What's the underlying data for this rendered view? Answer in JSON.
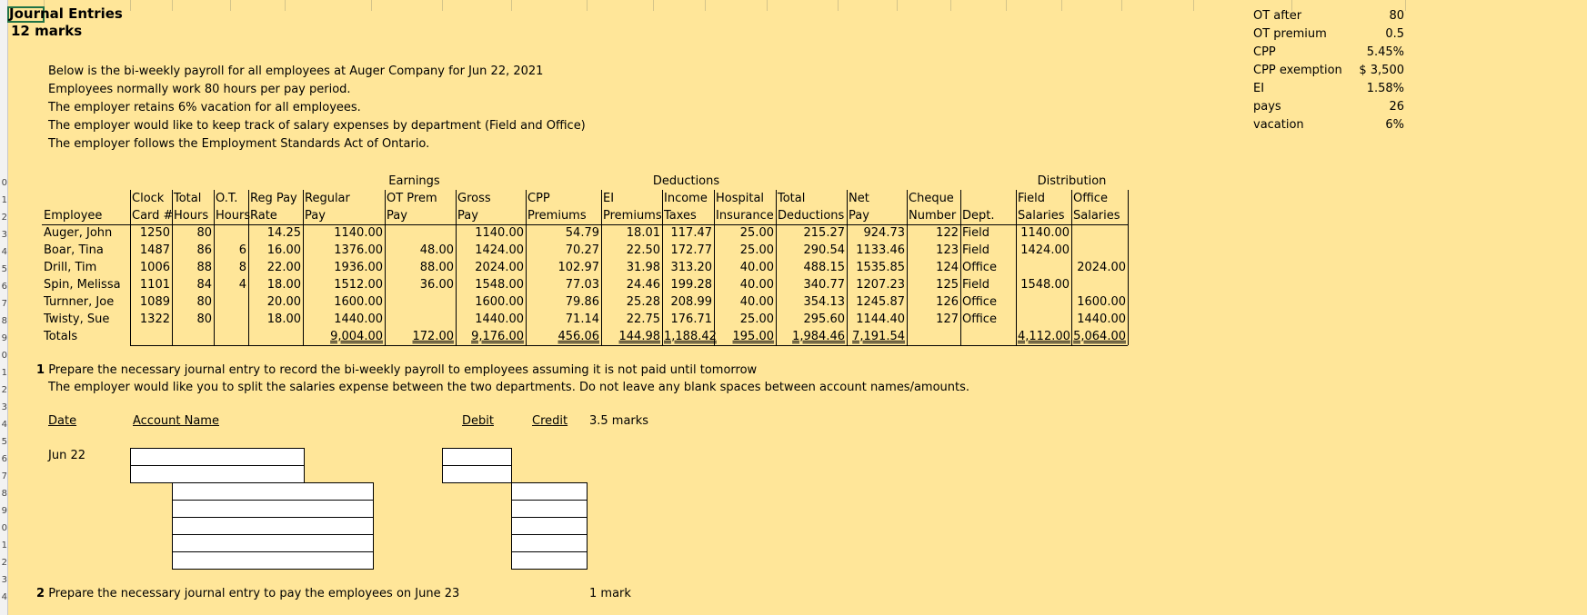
{
  "title": "Journal Entries",
  "marks": "12 marks",
  "intro": [
    "Below is the bi-weekly payroll for all employees at Auger Company for Jun 22, 2021",
    "Employees normally work 80 hours per pay period.",
    "The employer retains 6% vacation for all employees.",
    "The employer would like to keep track of salary expenses by department (Field and Office)",
    "The employer follows the Employment Standards Act of Ontario."
  ],
  "params": [
    {
      "label": "OT after",
      "value": "80"
    },
    {
      "label": "OT premium",
      "value": "0.5"
    },
    {
      "label": "CPP",
      "value": "5.45%"
    },
    {
      "label": "CPP exemption",
      "value": "$  3,500"
    },
    {
      "label": "EI",
      "value": "1.58%"
    },
    {
      "label": "pays",
      "value": "26"
    },
    {
      "label": "vacation",
      "value": "6%"
    }
  ],
  "groups": {
    "earnings": "Earnings",
    "deductions": "Deductions",
    "distribution": "Distribution"
  },
  "headers": {
    "row1": [
      "",
      "Clock",
      "Total",
      "O.T.",
      "Reg Pay",
      "Regular",
      "OT Prem",
      "Gross",
      "CPP",
      "EI",
      "Income",
      "Hospital",
      "Total",
      "Net",
      "Cheque",
      "",
      "Field",
      "Office"
    ],
    "row2": [
      "Employee",
      "Card #",
      "Hours",
      "Hours",
      "Rate",
      "Pay",
      "Pay",
      "Pay",
      "Premiums",
      "Premiums",
      "Taxes",
      "Insurance",
      "Deductions",
      "Pay",
      "Number",
      "Dept.",
      "Salaries",
      "Salaries"
    ]
  },
  "rows": [
    [
      "Auger, John",
      "1250",
      "80",
      "",
      "14.25",
      "1140.00",
      "",
      "1140.00",
      "54.79",
      "18.01",
      "117.47",
      "25.00",
      "215.27",
      "924.73",
      "122",
      "Field",
      "1140.00",
      ""
    ],
    [
      "Boar, Tina",
      "1487",
      "86",
      "6",
      "16.00",
      "1376.00",
      "48.00",
      "1424.00",
      "70.27",
      "22.50",
      "172.77",
      "25.00",
      "290.54",
      "1133.46",
      "123",
      "Field",
      "1424.00",
      ""
    ],
    [
      "Drill, Tim",
      "1006",
      "88",
      "8",
      "22.00",
      "1936.00",
      "88.00",
      "2024.00",
      "102.97",
      "31.98",
      "313.20",
      "40.00",
      "488.15",
      "1535.85",
      "124",
      "Office",
      "",
      "2024.00"
    ],
    [
      "Spin, Melissa",
      "1101",
      "84",
      "4",
      "18.00",
      "1512.00",
      "36.00",
      "1548.00",
      "77.03",
      "24.46",
      "199.28",
      "40.00",
      "340.77",
      "1207.23",
      "125",
      "Field",
      "1548.00",
      ""
    ],
    [
      "Turnner, Joe",
      "1089",
      "80",
      "",
      "20.00",
      "1600.00",
      "",
      "1600.00",
      "79.86",
      "25.28",
      "208.99",
      "40.00",
      "354.13",
      "1245.87",
      "126",
      "Office",
      "",
      "1600.00"
    ],
    [
      "Twisty, Sue",
      "1322",
      "80",
      "",
      "18.00",
      "1440.00",
      "",
      "1440.00",
      "71.14",
      "22.75",
      "176.71",
      "25.00",
      "295.60",
      "1144.40",
      "127",
      "Office",
      "",
      "1440.00"
    ]
  ],
  "totals": [
    "Totals",
    "",
    "",
    "",
    "",
    "9,004.00",
    "172.00",
    "9,176.00",
    "456.06",
    "144.98",
    "1,188.42",
    "195.00",
    "1,984.46",
    "7,191.54",
    "",
    "",
    "4,112.00",
    "5,064.00"
  ],
  "q1": {
    "number": "1",
    "line1": "Prepare the necessary journal entry to record the bi-weekly payroll to employees assuming it is not paid until tomorrow",
    "line2": "The employer would like you to split the salaries expense between the two departments.  Do not leave any blank spaces between account names/amounts."
  },
  "je_headers": {
    "date": "Date",
    "account": "Account Name",
    "debit": "Debit",
    "credit": "Credit",
    "marks": "3.5 marks"
  },
  "je_date": "Jun 22",
  "q2": {
    "number": "2",
    "text": "Prepare the necessary journal entry to pay the employees on June 23",
    "marks": "1 mark"
  }
}
